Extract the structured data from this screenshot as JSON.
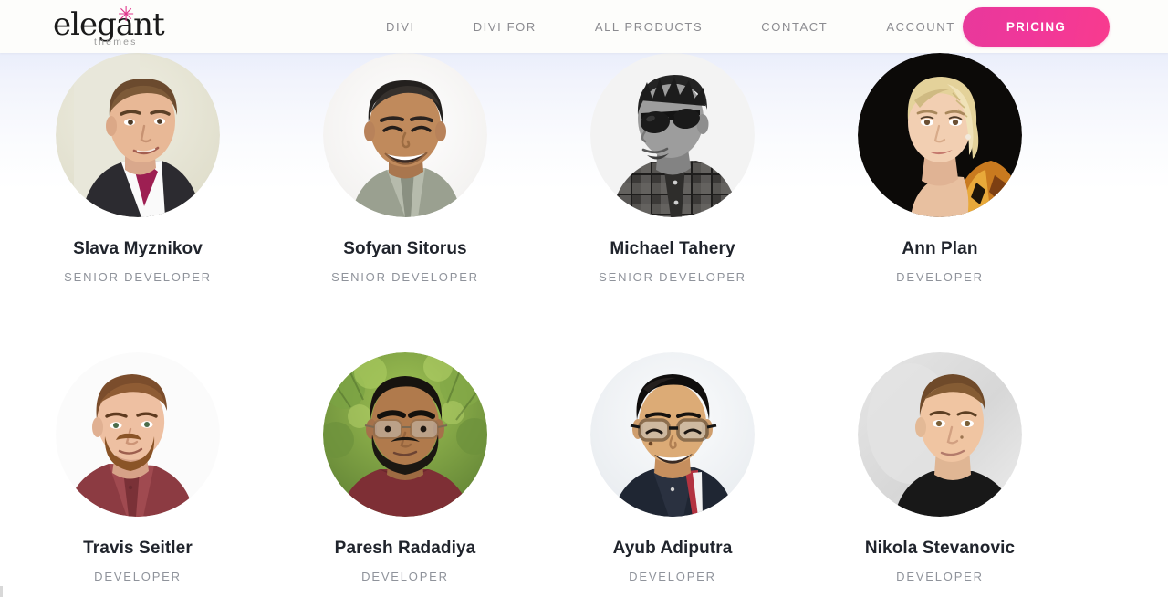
{
  "header": {
    "logo": {
      "word": "elegant",
      "star": "✳",
      "sub": "themes",
      "star_color": "#e0368b"
    },
    "nav": [
      {
        "label": "DIVI"
      },
      {
        "label": "DIVI FOR"
      },
      {
        "label": "ALL PRODUCTS"
      },
      {
        "label": "CONTACT"
      },
      {
        "label": "ACCOUNT"
      }
    ],
    "pricing_button": {
      "label": "PRICING",
      "color": "#ef3897"
    }
  },
  "team": {
    "rows": [
      {
        "members": [
          {
            "name": "Slava Myznikov",
            "role": "SENIOR DEVELOPER",
            "avatar": "portrait-slava-myznikov"
          },
          {
            "name": "Sofyan Sitorus",
            "role": "SENIOR DEVELOPER",
            "avatar": "portrait-sofyan-sitorus"
          },
          {
            "name": "Michael Tahery",
            "role": "SENIOR DEVELOPER",
            "avatar": "portrait-michael-tahery"
          },
          {
            "name": "Ann Plan",
            "role": "DEVELOPER",
            "avatar": "portrait-ann-plan"
          }
        ]
      },
      {
        "members": [
          {
            "name": "Travis Seitler",
            "role": "DEVELOPER",
            "avatar": "portrait-travis-seitler"
          },
          {
            "name": "Paresh Radadiya",
            "role": "DEVELOPER",
            "avatar": "portrait-paresh-radadiya"
          },
          {
            "name": "Ayub Adiputra",
            "role": "DEVELOPER",
            "avatar": "portrait-ayub-adiputra"
          },
          {
            "name": "Nikola Stevanovic",
            "role": "DEVELOPER",
            "avatar": "portrait-nikola-stevanovic"
          }
        ]
      }
    ]
  }
}
